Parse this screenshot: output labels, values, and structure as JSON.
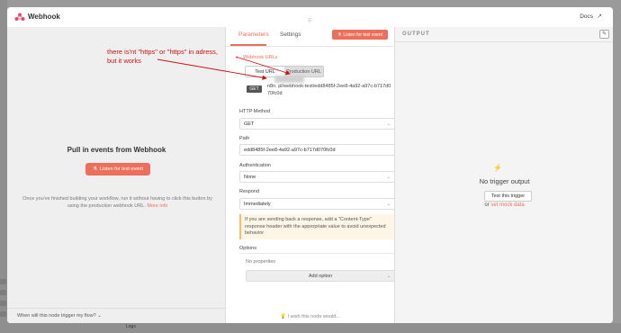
{
  "window": {
    "title": "Webhook",
    "docs_label": "Docs"
  },
  "left": {
    "title": "Pull in events from Webhook",
    "listen_label": "Listen for test event",
    "description": "Once you've finished building your workflow, run it without having to click this button by using the production webhook URL.",
    "more_info": "More info",
    "footer": "When will this node trigger my flow?"
  },
  "tabs": {
    "parameters": "Parameters",
    "settings": "Settings",
    "listen_label": "Listen for test event"
  },
  "params": {
    "webhook_urls_label": "Webhook URLs",
    "test_url_label": "Test URL",
    "production_url_label": "Production URL",
    "method_badge": "GET",
    "url_value": "n8n.             pl/webhook-test/edd8485f-2ee8-4a92-a97c-b717d070fc0d",
    "http_method_label": "HTTP Method",
    "http_method_value": "GET",
    "path_label": "Path",
    "path_value": "edd8485f-2ee8-4a92-a97c-b717d070fc0d",
    "auth_label": "Authentication",
    "auth_value": "None",
    "respond_label": "Respond",
    "respond_value": "Immediately",
    "notice": "If you are sending back a response, add a \"Content-Type\" response header with the appropriate value to avoid unexpected behavior",
    "options_label": "Options",
    "no_properties": "No properties",
    "add_option": "Add option",
    "wish": "I wish this node would..."
  },
  "output": {
    "label": "OUTPUT",
    "no_output": "No trigger output",
    "test_trigger": "Test this trigger",
    "or_text": "or",
    "mock_link": "set mock data"
  },
  "annotation": {
    "line1": "there is'nt \"https\" or \"https\" in adress,",
    "line2": "but it works"
  },
  "background": {
    "logs": "Logs"
  },
  "colors": {
    "accent": "#ec6f5c",
    "annotation": "#d01010"
  },
  "icons": [
    "n8n-logo-icon",
    "external-link-icon",
    "drag-handle-icon",
    "flask-icon",
    "chevron-down-icon",
    "bolt-icon",
    "edit-icon",
    "lightbulb-icon"
  ]
}
